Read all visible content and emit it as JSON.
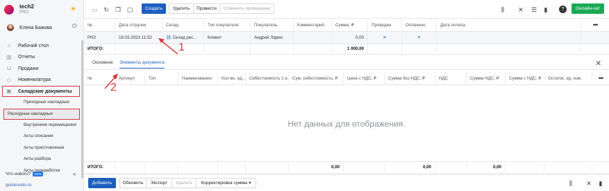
{
  "brand": {
    "name": "tech2",
    "plan": "PRO"
  },
  "user": {
    "name": "Елена Бажова"
  },
  "nav": [
    {
      "label": "Рабочий стол",
      "icon": "home-icon"
    },
    {
      "label": "Отчеты",
      "icon": "chart-icon"
    },
    {
      "label": "Продажи",
      "icon": "cart-icon"
    },
    {
      "label": "Номенклатура",
      "icon": "tag-icon"
    },
    {
      "label": "Складские документы",
      "icon": "box-icon"
    }
  ],
  "subnav": [
    "Приходные накладные",
    "Расходные накладные",
    "Внутренние перемещения",
    "Акты списания",
    "Акты приготовления",
    "Акты разбора",
    "Акты переработки"
  ],
  "sidebar_footer": {
    "whats_new": "Что нового?",
    "badge": "NEW",
    "site": "quickresto.ru"
  },
  "toolbar": {
    "create": "Создать",
    "delete": "Удалить",
    "post": "Провести",
    "cancel_post": "Отменить проведение",
    "online_chat": "Онлайн-чат"
  },
  "top_grid": {
    "headers": [
      "№",
      "Дата отгрузки",
      "Склад",
      "Тип покупателя",
      "Покупатель",
      "Комментарий",
      "Сумма, ₽",
      "Проведен",
      "Оплачено",
      "Дата оплаты"
    ],
    "row": {
      "num": "РН2",
      "date": "16.03.2023 11:52",
      "warehouse": "Склад рес...",
      "buyer_type": "Клиент",
      "buyer": "Андрей Ларин",
      "comment": "",
      "sum": "0,00",
      "posted": "✕",
      "paid": "✕",
      "pay_date": ""
    },
    "total": {
      "label": "ИТОГО:",
      "sum": "1 000,00"
    }
  },
  "tabs": [
    "Основное",
    "Элементы документа"
  ],
  "items_grid": {
    "headers": [
      "№",
      "Артикул",
      "Тип",
      "Наименование",
      "Кол-во, ед...",
      "Себестоимость 1 е...",
      "Сум. себестоимость, ₽",
      "Цена с НДС, ₽",
      "Сумма без НДС, ₽",
      "НДС",
      "Сумма НДС, ₽",
      "Сумма с НДС, ₽",
      "Остаток, ед. изм."
    ],
    "empty": "Нет данных для отображения.",
    "total": {
      "label": "ИТОГО:",
      "sum1": "0,00",
      "sum2": "0,00",
      "sum3": "0,00"
    }
  },
  "footer": {
    "add": "Добавить",
    "refresh": "Обновить",
    "export": "Экспорт",
    "delete": "Удалить",
    "adjust": "Корректировка суммы"
  },
  "annotations": [
    "1",
    "2"
  ],
  "colors": {
    "accent": "#1d5fbf",
    "green": "#1aaa55",
    "highlight": "#d9363e"
  }
}
